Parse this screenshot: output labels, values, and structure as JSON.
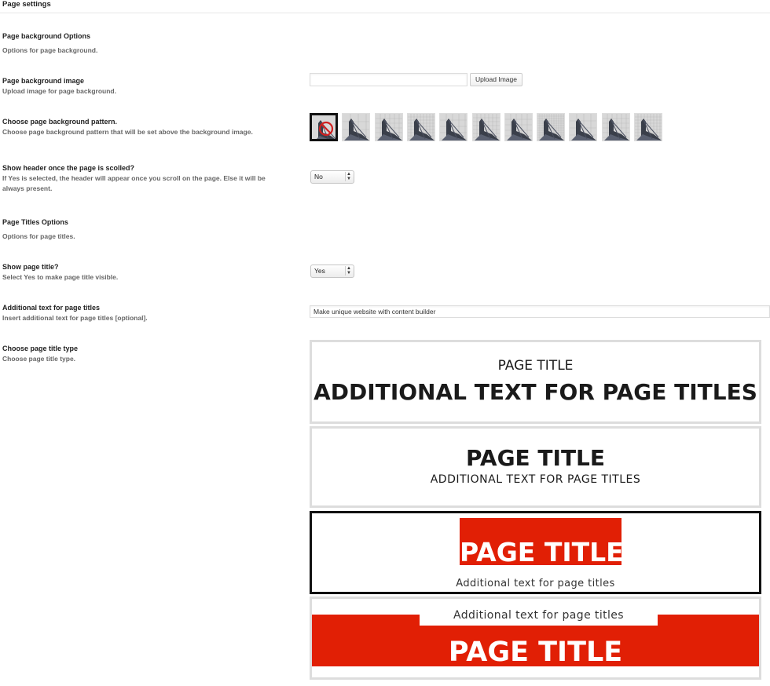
{
  "header": {
    "title": "Page settings"
  },
  "sections": {
    "background": {
      "title": "Page background Options",
      "desc": "Options for page background."
    },
    "titles": {
      "title": "Page Titles Options",
      "desc": "Options for page titles."
    }
  },
  "bg_image": {
    "label": "Page background image",
    "desc": "Upload image for page background.",
    "value": "",
    "button": "Upload Image"
  },
  "bg_pattern": {
    "label": "Choose page background pattern.",
    "desc": "Choose page background pattern that will be set above the background image.",
    "icons": [
      "no-pattern-icon",
      "pattern-1-icon",
      "pattern-2-icon",
      "pattern-3-icon",
      "pattern-4-icon",
      "pattern-5-icon",
      "pattern-6-icon",
      "pattern-7-icon",
      "pattern-8-icon",
      "pattern-9-icon",
      "pattern-10-icon"
    ]
  },
  "header_scroll": {
    "label": "Show header once the page is scolled?",
    "desc_line1": "If Yes is selected, the header will appear once you scroll on the page. Else it will be",
    "desc_line2": "always present.",
    "value": "No"
  },
  "show_title": {
    "label": "Show page title?",
    "desc": "Select Yes to make page title visible.",
    "value": "Yes"
  },
  "additional_text": {
    "label": "Additional text for page titles",
    "desc": "Insert additional text for page titles [optional].",
    "value": "Make unique website with content builder"
  },
  "title_type": {
    "label": "Choose page title type",
    "desc": "Choose page title type.",
    "opt1": {
      "small": "PAGE TITLE",
      "big": "ADDITIONAL TEXT FOR PAGE TITLES"
    },
    "opt2": {
      "big": "PAGE TITLE",
      "small": "ADDITIONAL TEXT FOR PAGE TITLES"
    },
    "opt3": {
      "big": "PAGE TITLE",
      "small": "Additional text for page titles"
    },
    "opt4": {
      "small": "Additional text for page titles",
      "big": "PAGE TITLE"
    }
  },
  "colors": {
    "accent_red": "#e11f05",
    "selected_border": "#111111",
    "box_border": "#dddddd"
  }
}
